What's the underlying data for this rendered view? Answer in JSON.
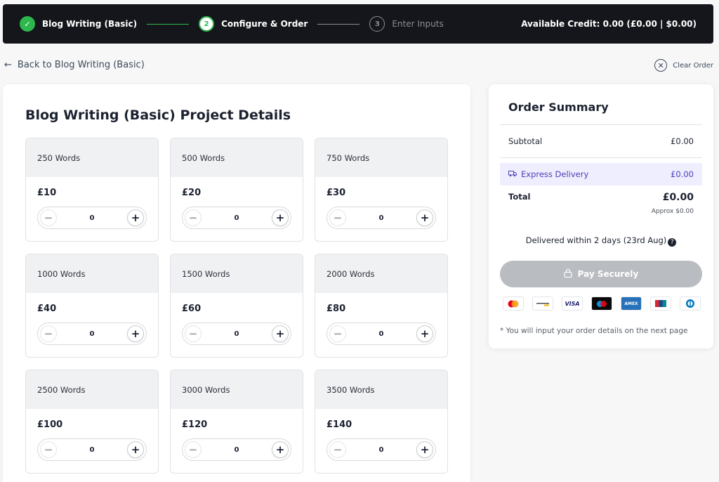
{
  "steps": [
    {
      "label": "Blog Writing (Basic)",
      "marker": "✓",
      "state": "done"
    },
    {
      "label": "Configure & Order",
      "marker": "2",
      "state": "active"
    },
    {
      "label": "Enter Inputs",
      "marker": "3",
      "state": "pending"
    }
  ],
  "credit_text": "Available Credit: 0.00 (£0.00 | $0.00)",
  "back_link": "Back to Blog Writing (Basic)",
  "clear_order": "Clear Order",
  "main": {
    "title": "Blog Writing (Basic) Project Details",
    "packages": [
      {
        "words": "250 Words",
        "price": "£10",
        "qty": "0"
      },
      {
        "words": "500 Words",
        "price": "£20",
        "qty": "0"
      },
      {
        "words": "750 Words",
        "price": "£30",
        "qty": "0"
      },
      {
        "words": "1000 Words",
        "price": "£40",
        "qty": "0"
      },
      {
        "words": "1500 Words",
        "price": "£60",
        "qty": "0"
      },
      {
        "words": "2000 Words",
        "price": "£80",
        "qty": "0"
      },
      {
        "words": "2500 Words",
        "price": "£100",
        "qty": "0"
      },
      {
        "words": "3000 Words",
        "price": "£120",
        "qty": "0"
      },
      {
        "words": "3500 Words",
        "price": "£140",
        "qty": "0"
      }
    ]
  },
  "summary": {
    "title": "Order Summary",
    "subtotal_label": "Subtotal",
    "subtotal_value": "£0.00",
    "express_label": "Express Delivery",
    "express_value": "£0.00",
    "total_label": "Total",
    "total_value": "£0.00",
    "approx": "Approx $0.00",
    "delivered": "Delivered within 2 days (23rd Aug)",
    "pay_button": "Pay Securely",
    "payment_methods": [
      "mastercard",
      "generic-card",
      "VISA",
      "maestro",
      "AMEX",
      "unionpay",
      "diners"
    ],
    "note": "* You will input your order details on the next page"
  },
  "colors": {
    "accent_green": "#2db84d",
    "express_bg": "#efeefe",
    "express_text": "#4a3fb5",
    "pay_disabled": "#b9bcc1"
  }
}
